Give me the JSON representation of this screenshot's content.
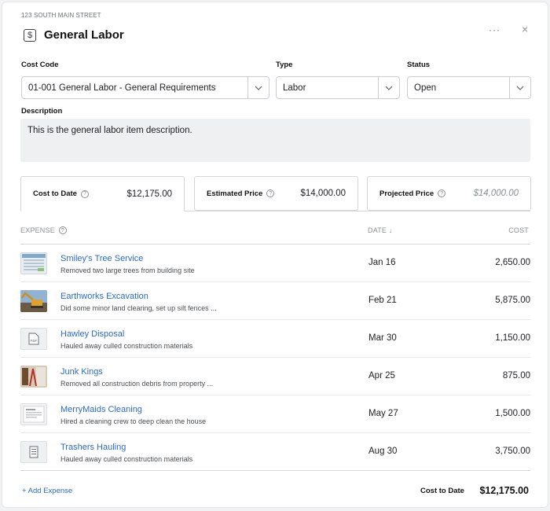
{
  "header": {
    "address": "123 SOUTH MAIN STREET",
    "icon": "dollar-icon",
    "title": "General Labor",
    "more_icon": "···",
    "close_icon": "×"
  },
  "fields": {
    "cost_code": {
      "label": "Cost Code",
      "value": "01-001 General Labor - General Requirements"
    },
    "type": {
      "label": "Type",
      "value": "Labor"
    },
    "status": {
      "label": "Status",
      "value": "Open"
    },
    "description": {
      "label": "Description",
      "value": "This is the general labor item description."
    }
  },
  "tabs": [
    {
      "label": "Cost to Date",
      "value": "$12,175.00",
      "active": true
    },
    {
      "label": "Estimated Price",
      "value": "$14,000.00",
      "active": false
    },
    {
      "label": "Projected Price",
      "value": "$14,000.00",
      "active": false
    }
  ],
  "table": {
    "headers": {
      "expense": "EXPENSE",
      "date": "DATE ↓",
      "cost": "COST"
    },
    "rows": [
      {
        "vendor": "Smiley's Tree Service",
        "note": "Removed two large trees from building site",
        "date": "Jan 16",
        "cost": "2,650.00",
        "thumb": "spreadsheet-thumbnail"
      },
      {
        "vendor": "Earthworks Excavation",
        "note": "Did some minor land clearing, set up silt fences ...",
        "date": "Feb 21",
        "cost": "5,875.00",
        "thumb": "excavator-photo"
      },
      {
        "vendor": "Hawley Disposal",
        "note": "Hauled away culled construction materials",
        "date": "Mar 30",
        "cost": "1,150.00",
        "thumb": "pdf-icon"
      },
      {
        "vendor": "Junk Kings",
        "note": "Removed all construction debris from property ...",
        "date": "Apr 25",
        "cost": "875.00",
        "thumb": "interior-photo"
      },
      {
        "vendor": "MerryMaids Cleaning",
        "note": "Hired a cleaning crew to deep clean the house",
        "date": "May 27",
        "cost": "1,500.00",
        "thumb": "receipt-thumbnail"
      },
      {
        "vendor": "Trashers Hauling",
        "note": "Hauled away culled construction materials",
        "date": "Aug 30",
        "cost": "3,750.00",
        "thumb": "document-icon"
      }
    ]
  },
  "footer": {
    "add_expense": "+ Add Expense",
    "total_label": "Cost to Date",
    "total_value": "$12,175.00"
  },
  "colors": {
    "link": "#2a6ac9",
    "description_bg": "#eef0f2"
  }
}
